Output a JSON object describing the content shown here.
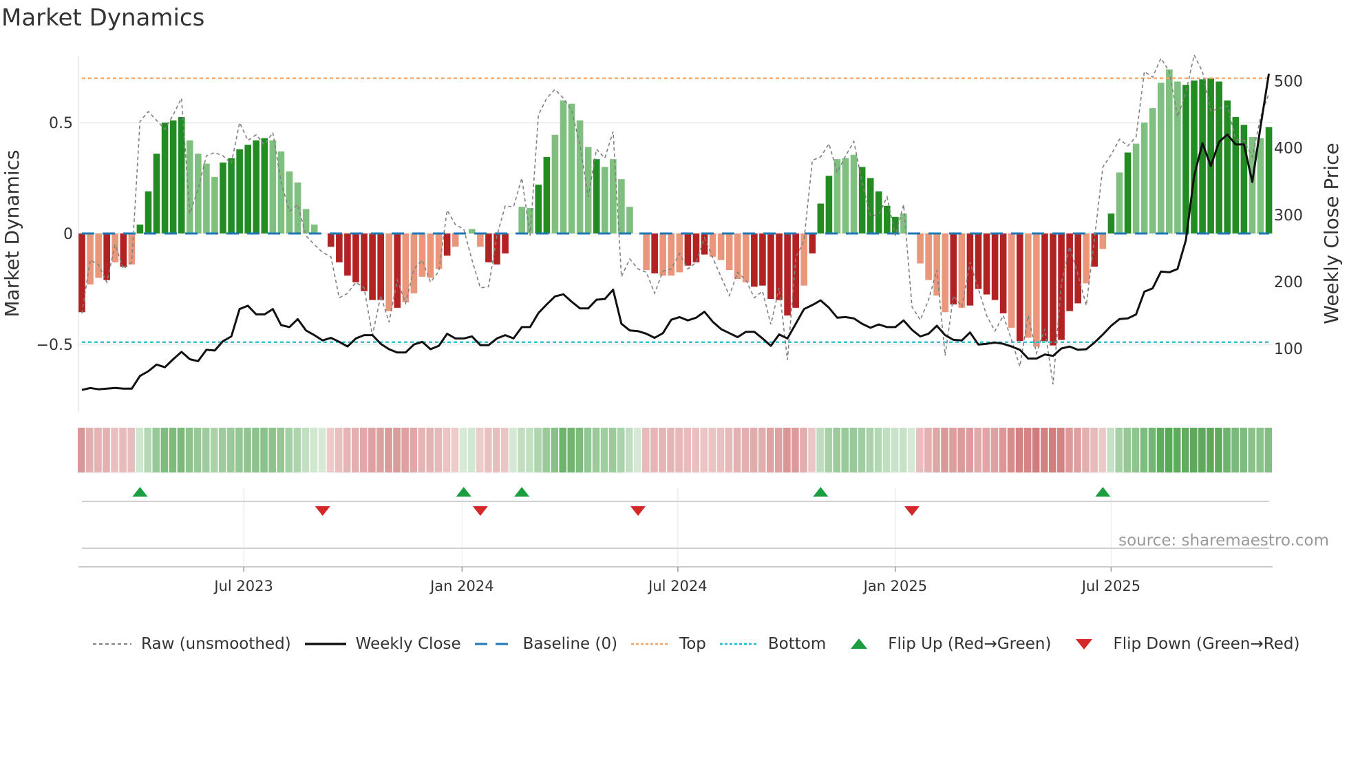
{
  "title": "Market Dynamics",
  "source": "source: sharemaestro.com",
  "legend": [
    {
      "key": "raw",
      "label": "Raw (unsmoothed)"
    },
    {
      "key": "close",
      "label": "Weekly Close"
    },
    {
      "key": "baseline",
      "label": "Baseline (0)"
    },
    {
      "key": "top",
      "label": "Top"
    },
    {
      "key": "bottom",
      "label": "Bottom"
    },
    {
      "key": "flip_up",
      "label": "Flip Up (Red→Green)"
    },
    {
      "key": "flip_down",
      "label": "Flip Down (Green→Red)"
    }
  ],
  "colors": {
    "pos_strong": "#228b22",
    "pos_weak": "#7fbf7f",
    "neg_strong": "#b22222",
    "neg_weak": "#e9967a",
    "raw": "#808080",
    "close": "#111111",
    "baseline": "#1f77b4",
    "top": "#f4a460",
    "bottom": "#17becf",
    "flip_up": "#1a9e3f",
    "flip_down": "#d62728"
  },
  "chart_data": {
    "type": "bar",
    "title": "Market Dynamics",
    "ylabel": "Market Dynamics",
    "y2label": "Weekly Close Price",
    "ylim": [
      -0.8,
      0.8
    ],
    "y2lim": [
      6,
      537
    ],
    "yticks": [
      {
        "v": 0.5,
        "label": "0.5"
      },
      {
        "v": 0,
        "label": "0"
      },
      {
        "v": -0.5,
        "label": "−0.5"
      }
    ],
    "y2ticks": [
      {
        "v": 500,
        "label": "500"
      },
      {
        "v": 400,
        "label": "400"
      },
      {
        "v": 300,
        "label": "300"
      },
      {
        "v": 200,
        "label": "200"
      },
      {
        "v": 100,
        "label": "100"
      }
    ],
    "xticks": [
      {
        "week": 19.5,
        "label": "Jul 2023"
      },
      {
        "week": 45.8,
        "label": "Jan 2024"
      },
      {
        "week": 71.8,
        "label": "Jul 2024"
      },
      {
        "week": 98.0,
        "label": "Jan 2025"
      },
      {
        "week": 124.0,
        "label": "Jul 2025"
      }
    ],
    "frequency": "weekly",
    "top_level": 0.7,
    "bottom_level": -0.49,
    "baseline": 0,
    "values": [
      -0.355,
      -0.23,
      -0.2,
      -0.21,
      -0.13,
      -0.15,
      -0.14,
      0.04,
      0.19,
      0.36,
      0.5,
      0.51,
      0.525,
      0.42,
      0.36,
      0.315,
      0.255,
      0.32,
      0.34,
      0.38,
      0.4,
      0.42,
      0.43,
      0.42,
      0.37,
      0.28,
      0.23,
      0.11,
      0.04,
      0,
      -0.06,
      -0.13,
      -0.19,
      -0.22,
      -0.26,
      -0.3,
      -0.3,
      -0.35,
      -0.335,
      -0.31,
      -0.27,
      -0.195,
      -0.2,
      -0.16,
      -0.1,
      -0.06,
      0,
      0.02,
      -0.06,
      -0.13,
      -0.14,
      -0.09,
      0,
      0.12,
      0.115,
      0.22,
      0.345,
      0.445,
      0.6,
      0.585,
      0.51,
      0.39,
      0.335,
      0.3,
      0.335,
      0.245,
      0.12,
      0,
      -0.165,
      -0.18,
      -0.19,
      -0.19,
      -0.175,
      -0.145,
      -0.13,
      -0.095,
      -0.105,
      -0.12,
      -0.165,
      -0.205,
      -0.22,
      -0.24,
      -0.235,
      -0.295,
      -0.3,
      -0.37,
      -0.335,
      -0.235,
      -0.09,
      0.135,
      0.26,
      0.335,
      0.34,
      0.355,
      0.3,
      0.25,
      0.19,
      0.125,
      0.075,
      0.09,
      0,
      -0.135,
      -0.21,
      -0.28,
      -0.355,
      -0.32,
      -0.335,
      -0.325,
      -0.25,
      -0.275,
      -0.3,
      -0.36,
      -0.425,
      -0.485,
      -0.47,
      -0.51,
      -0.485,
      -0.505,
      -0.48,
      -0.35,
      -0.315,
      -0.225,
      -0.15,
      -0.07,
      0.09,
      0.275,
      0.365,
      0.405,
      0.5,
      0.565,
      0.68,
      0.74,
      0.685,
      0.67,
      0.69,
      0.695,
      0.7,
      0.685,
      0.6,
      0.525,
      0.49,
      0.435,
      0.43,
      0.48
    ],
    "strength": "dlldldlddddddlllldddddd llllllndddddddldllllldlllnddddlnddllllldlllllldllndddlllllddddddldddllldddddlllllldndddddldlldddddldldldllllllddddddddllddddllllllld",
    "raw": [
      -0.36,
      -0.12,
      -0.14,
      -0.22,
      -0.05,
      -0.16,
      -0.13,
      0.505,
      0.55,
      0.51,
      0.47,
      0.535,
      0.61,
      0.09,
      0.2,
      0.35,
      0.365,
      0.35,
      0.315,
      0.5,
      0.42,
      0.445,
      0.4,
      0.455,
      0.23,
      0.1,
      0.13,
      -0.01,
      -0.05,
      -0.085,
      -0.105,
      -0.29,
      -0.27,
      -0.22,
      -0.245,
      -0.46,
      -0.28,
      -0.4,
      -0.21,
      -0.315,
      -0.16,
      -0.12,
      -0.22,
      -0.17,
      0.105,
      0.04,
      0.02,
      -0.12,
      -0.245,
      -0.24,
      -0.01,
      0.125,
      0.12,
      0.25,
      -0.01,
      0.535,
      0.61,
      0.65,
      0.61,
      0.555,
      0.4,
      0.165,
      0.38,
      0.34,
      0.46,
      -0.195,
      -0.115,
      -0.16,
      -0.175,
      -0.27,
      -0.17,
      -0.16,
      -0.09,
      -0.16,
      -0.13,
      -0.02,
      -0.11,
      -0.195,
      -0.28,
      -0.175,
      -0.21,
      -0.29,
      -0.26,
      -0.41,
      -0.245,
      -0.57,
      -0.11,
      -0.03,
      0.33,
      0.345,
      0.405,
      0.275,
      0.35,
      0.415,
      0.23,
      0.08,
      0.085,
      0.165,
      -0.01,
      0.13,
      -0.33,
      -0.39,
      -0.3,
      -0.165,
      -0.55,
      -0.28,
      -0.33,
      -0.13,
      -0.25,
      -0.37,
      -0.44,
      -0.37,
      -0.48,
      -0.6,
      -0.37,
      -0.54,
      -0.43,
      -0.68,
      -0.225,
      -0.06,
      -0.185,
      -0.325,
      -0.02,
      0.3,
      0.355,
      0.425,
      0.395,
      0.435,
      0.73,
      0.705,
      0.79,
      0.73,
      0.525,
      0.635,
      0.805,
      0.73,
      0.55,
      0.565,
      0.575,
      0.425,
      0.42,
      0.345,
      0.525,
      0.63
    ],
    "close": [
      38,
      41,
      39,
      40,
      41,
      40,
      40,
      59,
      66,
      76,
      72,
      84,
      95,
      84,
      81,
      98,
      97,
      111,
      118,
      159,
      164,
      151,
      151,
      159,
      135,
      132,
      144,
      127,
      120,
      112,
      116,
      110,
      103,
      115,
      120,
      120,
      107,
      99,
      94,
      94,
      106,
      110,
      99,
      104,
      122,
      115,
      115,
      118,
      105,
      105,
      115,
      120,
      115,
      132,
      132,
      153,
      166,
      178,
      181,
      170,
      160,
      160,
      173,
      174,
      188,
      137,
      127,
      126,
      122,
      116,
      123,
      143,
      147,
      142,
      146,
      155,
      140,
      129,
      123,
      117,
      125,
      125,
      115,
      104,
      121,
      115,
      137,
      159,
      165,
      172,
      161,
      146,
      147,
      145,
      137,
      131,
      136,
      132,
      132,
      142,
      128,
      118,
      122,
      134,
      120,
      113,
      112,
      124,
      106,
      107,
      109,
      107,
      103,
      98,
      85,
      85,
      91,
      89,
      100,
      103,
      98,
      99,
      109,
      121,
      134,
      144,
      145,
      151,
      185,
      190,
      215,
      214,
      219,
      262,
      358,
      407,
      373,
      409,
      420,
      405,
      405,
      349,
      432,
      511
    ],
    "flip_up_weeks": [
      7,
      46,
      53,
      89,
      123
    ],
    "flip_down_weeks": [
      29,
      48,
      67,
      100
    ]
  }
}
